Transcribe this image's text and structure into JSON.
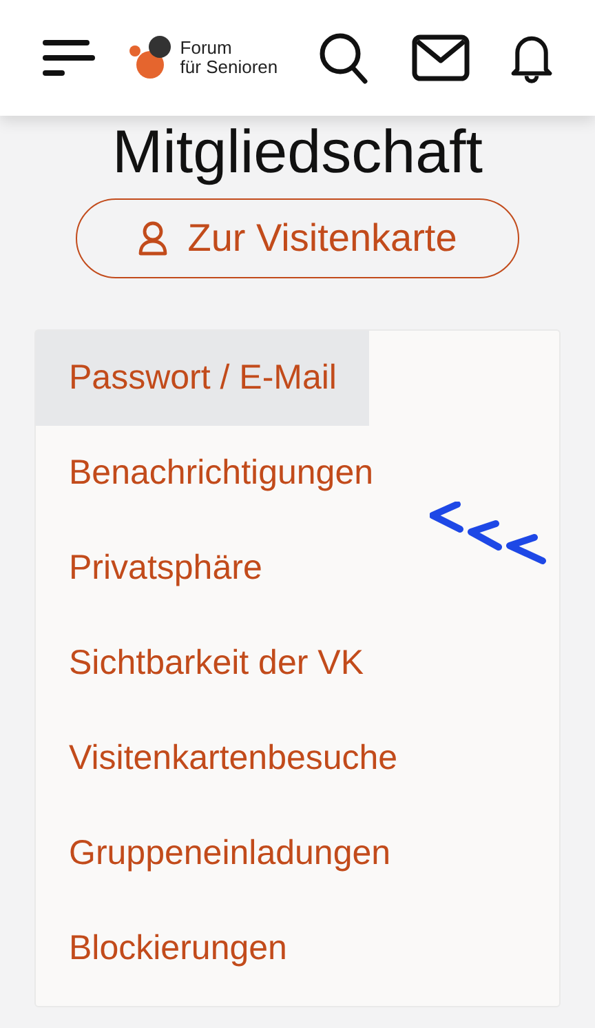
{
  "header": {
    "logo": {
      "line_1": "Forum",
      "line_2": "für Senioren"
    }
  },
  "title": "Mitgliedschaft",
  "profile_button": {
    "label": "Zur Visitenkarte"
  },
  "menu": [
    {
      "label": "Passwort / E-Mail",
      "selected": true
    },
    {
      "label": "Benachrichtigungen",
      "selected": false
    },
    {
      "label": "Privatsphäre",
      "selected": false
    },
    {
      "label": "Sichtbarkeit der VK",
      "selected": false
    },
    {
      "label": "Visitenkartenbesuche",
      "selected": false
    },
    {
      "label": "Gruppeneinladungen",
      "selected": false
    },
    {
      "label": "Blockierungen",
      "selected": false
    }
  ]
}
